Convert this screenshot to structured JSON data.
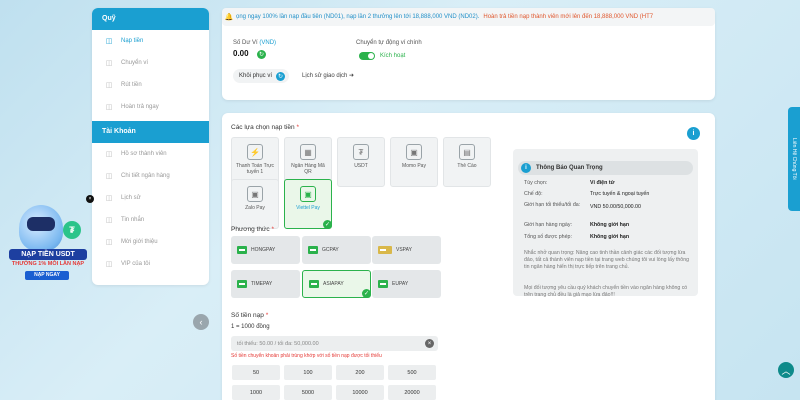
{
  "sidebar": {
    "wallet_header": "Quỹ",
    "wallet_items": [
      {
        "label": "Nạp tiền",
        "icon": "deposit-icon",
        "active": true
      },
      {
        "label": "Chuyển ví",
        "icon": "transfer-icon",
        "active": false
      },
      {
        "label": "Rút tiền",
        "icon": "withdraw-icon",
        "active": false
      },
      {
        "label": "Hoàn trả ngay",
        "icon": "rebate-icon",
        "active": false
      }
    ],
    "account_header": "Tài Khoản",
    "account_items": [
      {
        "label": "Hồ sơ thành viên",
        "icon": "profile-icon"
      },
      {
        "label": "Chi tiết ngân hàng",
        "icon": "bank-icon"
      },
      {
        "label": "Lịch sử",
        "icon": "history-icon"
      },
      {
        "label": "Tin nhắn",
        "icon": "message-icon"
      },
      {
        "label": "Mời giới thiệu",
        "icon": "referral-icon"
      },
      {
        "label": "VIP của tôi",
        "icon": "vip-icon"
      }
    ],
    "collapse_glyph": "‹"
  },
  "ticker": {
    "bell_glyph": "🔔",
    "text_blue": "ọng ngay 100% lần nạp đầu tiên (ND01), nạp lần 2 thưởng lên tới 18,888,000 VND (ND02).",
    "text_orange": "Hoàn trả tiền nạp thành viên mới lên đến 18,888,000 VND (HT7"
  },
  "wallet": {
    "balance_label": "Số Dư Ví",
    "balance_unit": "(VND)",
    "balance_value": "0.00",
    "auto_label": "Chuyển tự động ví chính",
    "auto_state": "Kích hoạt",
    "restore_label": "Khôi phục ví",
    "history_link": "Lịch sử giao dịch",
    "arrow": "➜"
  },
  "deposit": {
    "options_title": "Các lựa chọn nạp tiền",
    "required_mark": "*",
    "methods": [
      {
        "label": "Thanh Toán Trực tuyến 1",
        "glyph": "⚡",
        "selected": false
      },
      {
        "label": "Ngân Hàng Mã QR",
        "glyph": "▦",
        "selected": false
      },
      {
        "label": "USDT",
        "glyph": "₮",
        "selected": false
      },
      {
        "label": "Momo Pay",
        "glyph": "▣",
        "selected": false
      },
      {
        "label": "Thẻ Cào",
        "glyph": "▤",
        "selected": false
      },
      {
        "label": "Zalo Pay",
        "glyph": "▣",
        "selected": false
      },
      {
        "label": "Viettel Pay",
        "glyph": "▣",
        "selected": true
      }
    ],
    "channel_title": "Phương thức",
    "channels": [
      {
        "label": "HONGPAY",
        "selected": false
      },
      {
        "label": "GCPAY",
        "selected": false
      },
      {
        "label": "VSPAY",
        "selected": false
      },
      {
        "label": "TIMEPAY",
        "selected": false
      },
      {
        "label": "ASIAPAY",
        "selected": true
      },
      {
        "label": "EUPAY",
        "selected": false
      }
    ],
    "amount_title": "Số tiền nạp",
    "rate": "1 = 1000 đồng",
    "amount_placeholder": "tối thiểu: 50.00 / tối đa: 50,000.00",
    "amount_warning": "Số tiền chuyển khoản phải trùng khớp với số tiền nạp được tối thiểu",
    "quick_amounts": [
      "50",
      "100",
      "200",
      "500",
      "1000",
      "5000",
      "10000",
      "20000"
    ],
    "check_glyph": "✓",
    "clear_glyph": "×"
  },
  "notice": {
    "title": "Thông Báo Quan Trọng",
    "rows": [
      {
        "key": "Tùy chọn:",
        "value": "Ví điện tử",
        "bold": true
      },
      {
        "key": "Chế độ:",
        "value": "Trực tuyến & ngoại tuyến",
        "bold": false
      },
      {
        "key": "Giới hạn tối thiểu/tối đa:",
        "value": "VND 50.00/50,000.00",
        "bold": false
      },
      {
        "key": "Giới hạn hàng ngày:",
        "value": "Không giới hạn",
        "bold": true
      },
      {
        "key": "Tổng số được phép:",
        "value": "Không giới hạn",
        "bold": true
      }
    ],
    "text1": "Nhắc nhở quan trọng: Nâng cao tinh thần cảnh giác các đối tượng lừa đảo, tất cả thành viên nạp tiền tại trang web chúng tôi vui lòng lấy thông tin ngân hàng hiển thị trực tiếp trên trang chủ.",
    "text2": "Mọi đối tượng yêu cầu quý khách chuyển tiền vào ngân hàng không có trên trang chủ đều là giả mạo lừa đảo!!!"
  },
  "side_tab": "Liên Hệ Chúng Tôi",
  "promo": {
    "title": "NẠP TIỀN USDT",
    "subtitle": "THƯỞNG 1% MỖI LẦN NẠP",
    "cta": "NẠP NGAY",
    "coin": "₮"
  },
  "colors": {
    "accent": "#1a9fd1",
    "success": "#2bb24c",
    "danger": "#e53935"
  }
}
